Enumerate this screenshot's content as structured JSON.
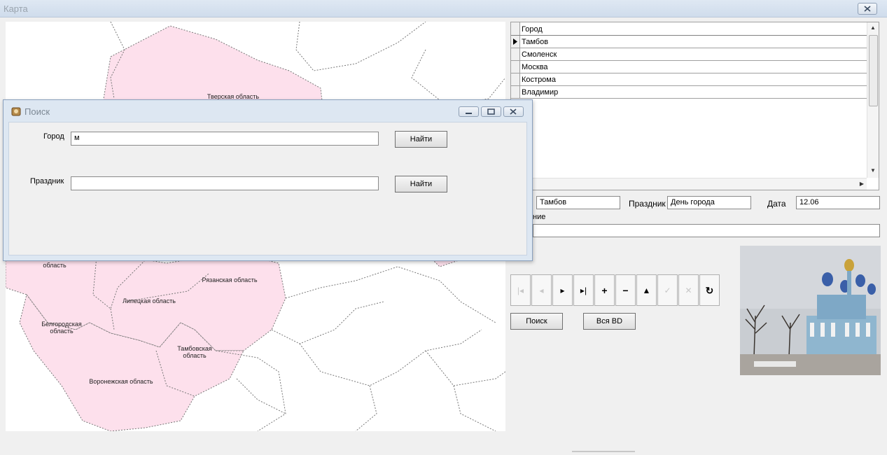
{
  "window": {
    "title": "Карта"
  },
  "map": {
    "regions": [
      "Тверская область",
      "область",
      "Рязанская область",
      "Липецкая область",
      "Белгородская\nобласть",
      "Тамбовская\nобласть",
      "Воронежская область"
    ]
  },
  "grid": {
    "header": "Город",
    "rows": [
      "Тамбов",
      "Смоленск",
      "Москва",
      "Кострома",
      "Владимир"
    ],
    "selected_index": 0
  },
  "detail": {
    "city_value": "Тамбов",
    "holiday_label": "Праздник",
    "holiday_value": "День города",
    "date_label": "Дата",
    "date_value": "12.06",
    "desc_label_partial": "ние",
    "desc_value": ""
  },
  "navigator": {
    "buttons": [
      {
        "icon": "first-record-icon",
        "glyph": "|◂",
        "enabled": false
      },
      {
        "icon": "prior-record-icon",
        "glyph": "◂",
        "enabled": false
      },
      {
        "icon": "next-record-icon",
        "glyph": "▸",
        "enabled": true
      },
      {
        "icon": "last-record-icon",
        "glyph": "▸|",
        "enabled": true
      },
      {
        "icon": "insert-record-icon",
        "glyph": "+",
        "enabled": true
      },
      {
        "icon": "delete-record-icon",
        "glyph": "−",
        "enabled": true
      },
      {
        "icon": "edit-record-icon",
        "glyph": "▲",
        "enabled": true
      },
      {
        "icon": "post-record-icon",
        "glyph": "✓",
        "enabled": false
      },
      {
        "icon": "cancel-record-icon",
        "glyph": "✕",
        "enabled": false
      },
      {
        "icon": "refresh-icon",
        "glyph": "↻",
        "enabled": true
      }
    ]
  },
  "buttons": {
    "search": "Поиск",
    "all_db": "Вся BD"
  },
  "search_dialog": {
    "title": "Поиск",
    "city_label": "Город",
    "city_value": "м",
    "holiday_label": "Праздник",
    "holiday_value": "",
    "find_label_1": "Найти",
    "find_label_2": "Найти"
  },
  "colors": {
    "region_fill": "#fde0ec",
    "title_bar": "#cfdcec"
  }
}
